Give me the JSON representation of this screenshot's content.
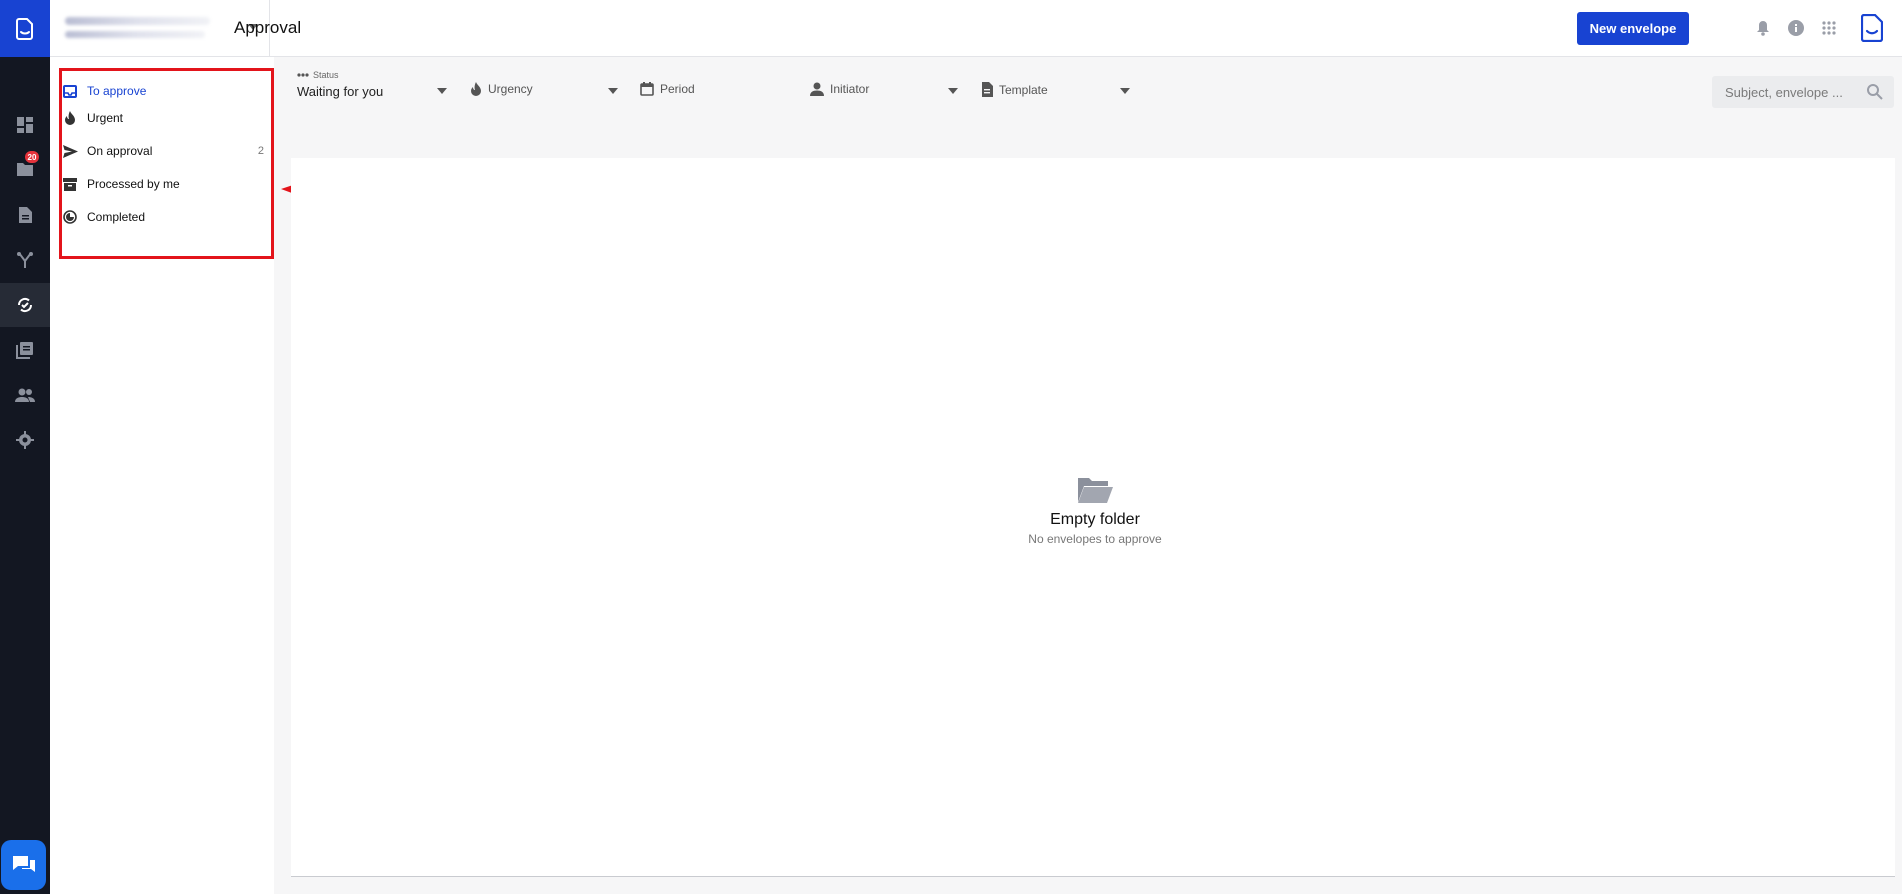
{
  "header": {
    "title": "Approval",
    "new_envelope_label": "New envelope"
  },
  "rail": {
    "folder_badge_count": "20"
  },
  "nav": {
    "items": [
      {
        "label": "To approve",
        "icon": "inbox-icon",
        "count": "",
        "active": true
      },
      {
        "label": "Urgent",
        "icon": "flame-icon",
        "count": ""
      },
      {
        "label": "On approval",
        "icon": "send-icon",
        "count": "2"
      },
      {
        "label": "Processed by me",
        "icon": "archive-icon",
        "count": ""
      },
      {
        "label": "Completed",
        "icon": "clock-done-icon",
        "count": ""
      }
    ]
  },
  "filters": {
    "status": {
      "caption": "Status",
      "value": "Waiting for you"
    },
    "urgency": {
      "label": "Urgency"
    },
    "period": {
      "label": "Period"
    },
    "initiator": {
      "label": "Initiator"
    },
    "template": {
      "label": "Template"
    }
  },
  "search": {
    "placeholder": "Subject, envelope ..."
  },
  "empty_state": {
    "title": "Empty folder",
    "subtitle": "No envelopes to approve"
  },
  "colors": {
    "accent": "#1843d2",
    "rail_bg": "#131722",
    "annotation": "#e3141b",
    "badge": "#e5333b"
  }
}
